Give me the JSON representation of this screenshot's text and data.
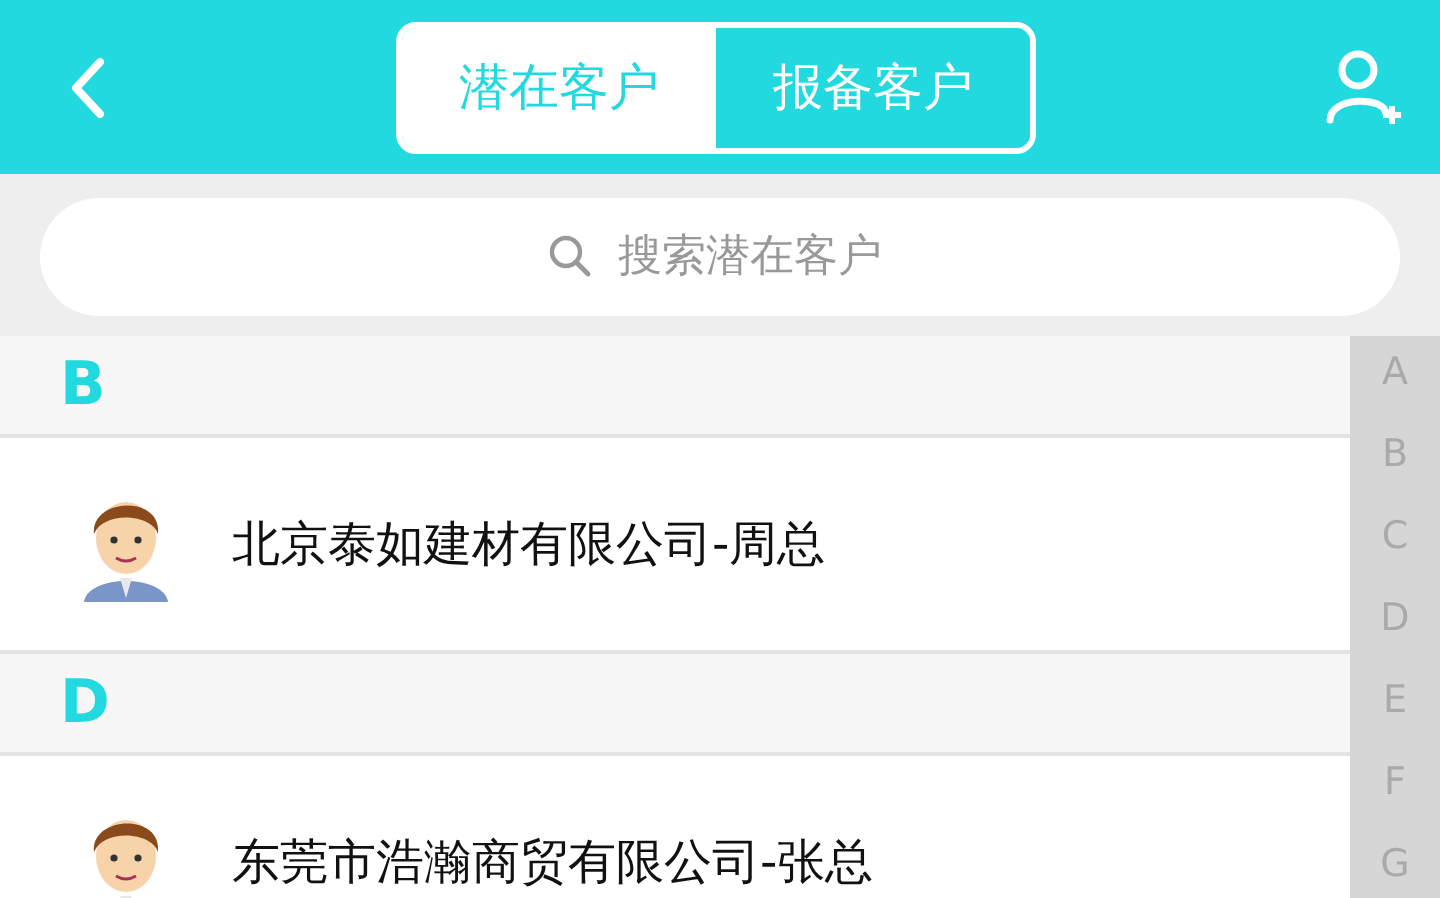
{
  "header": {
    "tabs": [
      {
        "label": "潜在客户",
        "selected": true
      },
      {
        "label": "报备客户",
        "selected": false
      }
    ]
  },
  "search": {
    "placeholder": "搜索潜在客户"
  },
  "sections": [
    {
      "letter": "B",
      "items": [
        {
          "name": "北京泰如建材有限公司-周总"
        }
      ]
    },
    {
      "letter": "D",
      "items": [
        {
          "name": "东莞市浩瀚商贸有限公司-张总"
        }
      ]
    }
  ],
  "index": [
    "A",
    "B",
    "C",
    "D",
    "E",
    "F",
    "G"
  ]
}
